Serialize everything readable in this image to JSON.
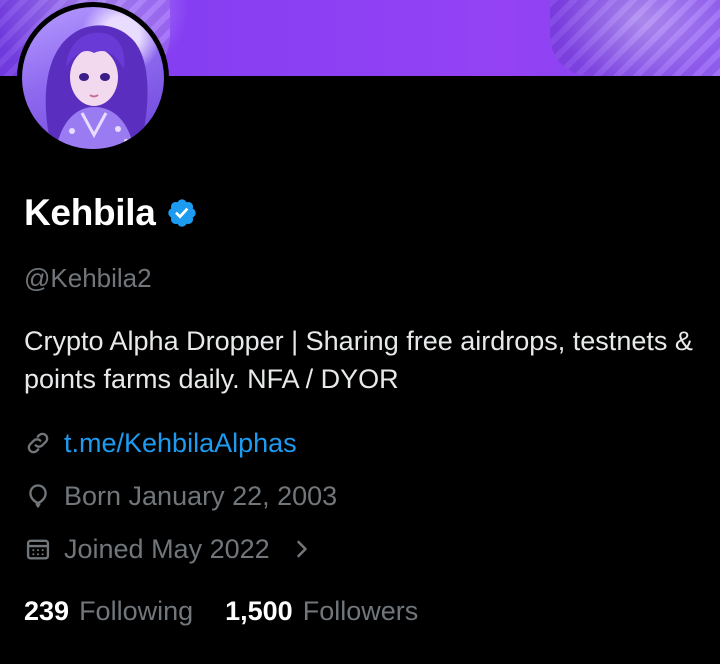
{
  "profile": {
    "display_name": "Kehbila",
    "handle": "@Kehbila2",
    "bio": "Crypto Alpha Dropper | Sharing free airdrops, testnets & points farms daily. NFA / DYOR",
    "verified_badge_icon": "verified-checkmark-icon",
    "accent_color": "#1d9bf0",
    "banner_color": "#8a3ff3"
  },
  "meta": {
    "link": {
      "icon": "link-icon",
      "text": "t.me/KehbilaAlphas"
    },
    "born": {
      "icon": "balloon-icon",
      "text": "Born January 22, 2003"
    },
    "joined": {
      "icon": "calendar-icon",
      "text": "Joined May 2022",
      "chevron_icon": "chevron-right-icon"
    }
  },
  "stats": {
    "following_count": "239",
    "following_label": "Following",
    "followers_count": "1,500",
    "followers_label": "Followers"
  }
}
